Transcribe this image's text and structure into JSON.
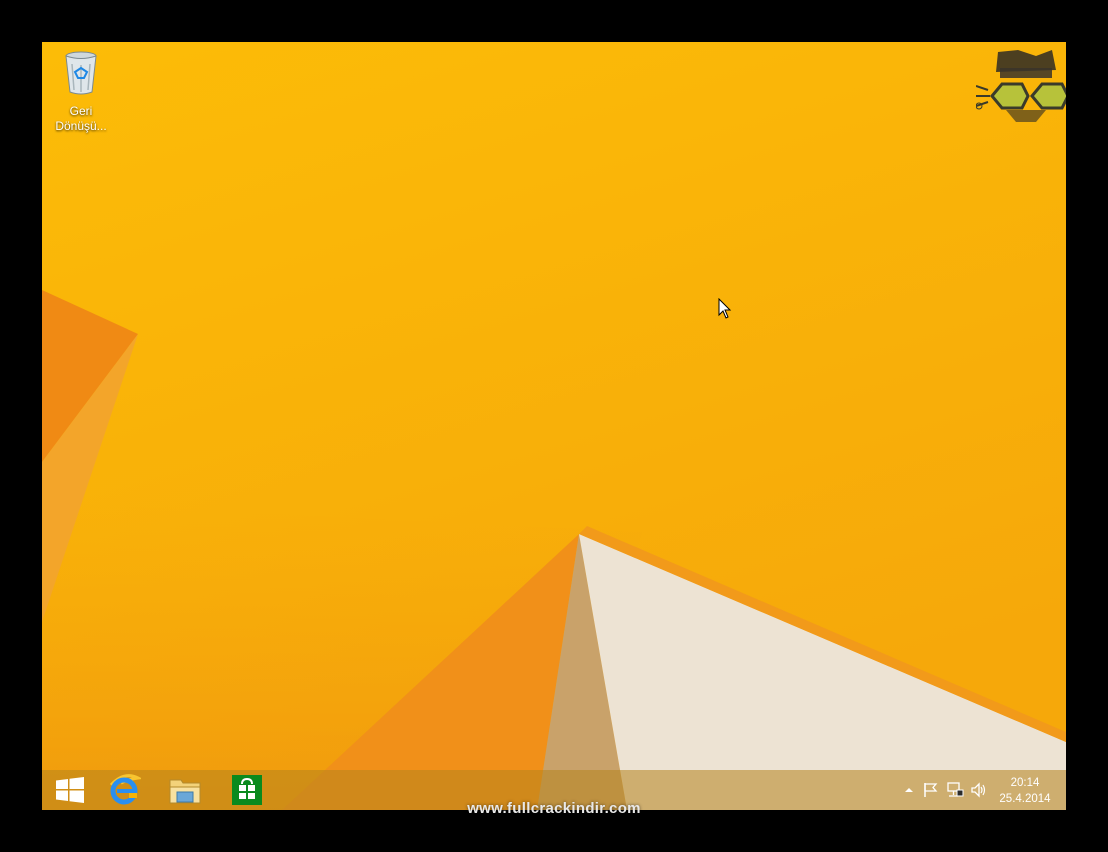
{
  "desktop": {
    "icons": [
      {
        "label_line1": "Geri",
        "label_line2": "Dönüşü..."
      }
    ]
  },
  "taskbar": {
    "start": {
      "icon": "windows-logo-icon"
    },
    "pinned": [
      {
        "name": "internet-explorer",
        "icon": "internet-explorer-icon"
      },
      {
        "name": "file-explorer",
        "icon": "folder-icon"
      },
      {
        "name": "store",
        "icon": "store-icon"
      }
    ],
    "tray": {
      "icons": [
        "show-hidden-icons-icon",
        "action-center-flag-icon",
        "network-icon",
        "volume-icon"
      ],
      "clock": {
        "time": "20:14",
        "date": "25.4.2014"
      }
    }
  },
  "watermark": {
    "text": "www.fullcrackindir.com"
  },
  "colors": {
    "wallpaper_top": "#fbbd08",
    "wallpaper_bottom": "#f5a00a",
    "shard_orange": "#ef8a12",
    "shard_white": "#ede3d2",
    "taskbar": "#b8861e",
    "logo_green": "#b7c23a"
  }
}
